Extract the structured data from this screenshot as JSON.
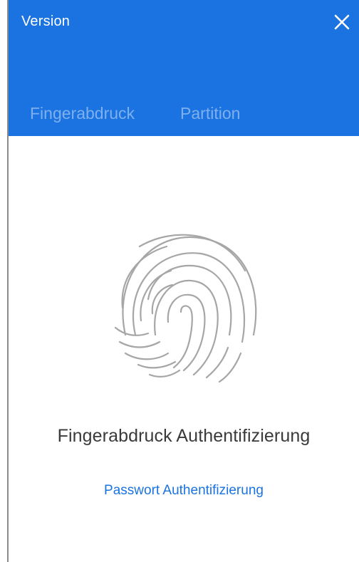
{
  "header": {
    "title": "Version",
    "accent_color": "#1a73e1"
  },
  "tabs": [
    {
      "label": "Fingerabdruck"
    },
    {
      "label": "Partition"
    }
  ],
  "main": {
    "icon": "fingerprint-icon",
    "title": "Fingerabdruck Authentifizierung",
    "alt_link": "Passwort Authentifizierung"
  }
}
